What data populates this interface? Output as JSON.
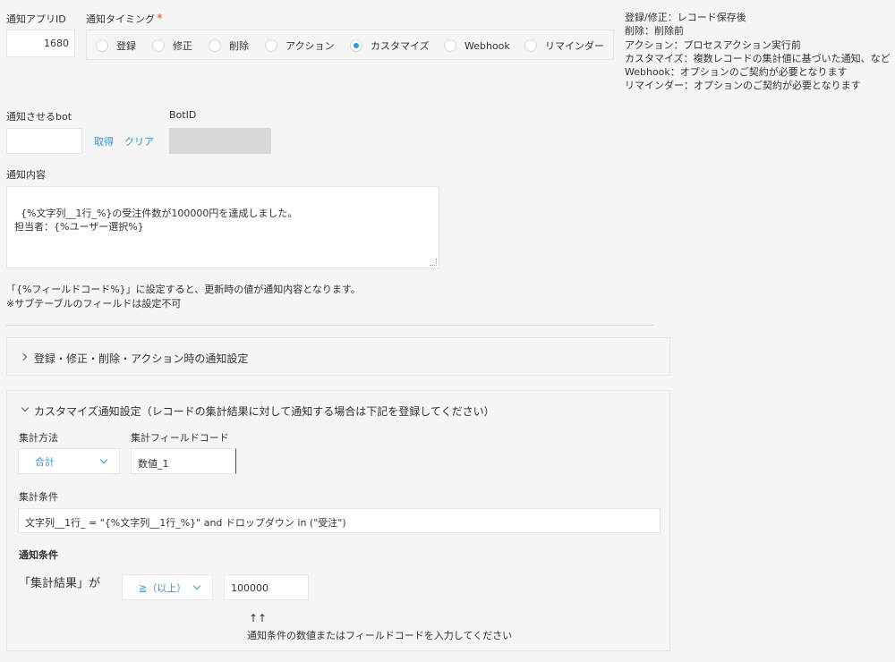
{
  "app_id": {
    "label": "通知アプリID",
    "value": "1680"
  },
  "timing": {
    "label": "通知タイミング",
    "required_mark": "*",
    "options": [
      "登録",
      "修正",
      "削除",
      "アクション",
      "カスタマイズ",
      "Webhook",
      "リマインダー"
    ],
    "selected": "カスタマイズ"
  },
  "timing_help": [
    "登録/修正：レコード保存後",
    "削除：削除前",
    "アクション：プロセスアクション実行前",
    "カスタマイズ：複数レコードの集計値に基づいた通知、など",
    "Webhook：オプションのご契約が必要となります",
    "リマインダー：オプションのご契約が必要となります"
  ],
  "bot": {
    "label": "通知させるbot",
    "value": "",
    "get_label": "取得",
    "clear_label": "クリア"
  },
  "bot_id": {
    "label": "BotID",
    "value": ""
  },
  "content": {
    "label": "通知内容",
    "value": "{%文字列__1行_%}の受注件数が100000円を達成しました。\n担当者：{%ユーザー選択%}"
  },
  "content_note": [
    "「{%フィールドコード%}」に設定すると、更新時の値が通知内容となります。",
    "※サブテーブルのフィールドは設定不可"
  ],
  "section_basic": {
    "title": "登録・修正・削除・アクション時の通知設定",
    "expanded": false
  },
  "section_custom": {
    "title": "カスタマイズ通知設定（レコードの集計結果に対して通知する場合は下記を登録してください）",
    "expanded": true,
    "agg_method": {
      "label": "集計方法",
      "value": "合計"
    },
    "agg_field": {
      "label": "集計フィールドコード",
      "value": "数値_1"
    },
    "agg_condition": {
      "label": "集計条件",
      "value": "文字列__1行_ = \"{%文字列__1行_%}\" and ドロップダウン in (\"受注\")"
    },
    "notify_condition": {
      "label": "通知条件",
      "prefix": "「集計結果」が",
      "operator": "≧（以上）",
      "value": "100000",
      "arrows": "↑↑",
      "hint": "通知条件の数値またはフィールドコードを入力してください"
    }
  },
  "colors": {
    "accent": "#3498db",
    "required": "#e74c3c",
    "border": "#e3e7e8",
    "background": "#f5f5f5"
  }
}
